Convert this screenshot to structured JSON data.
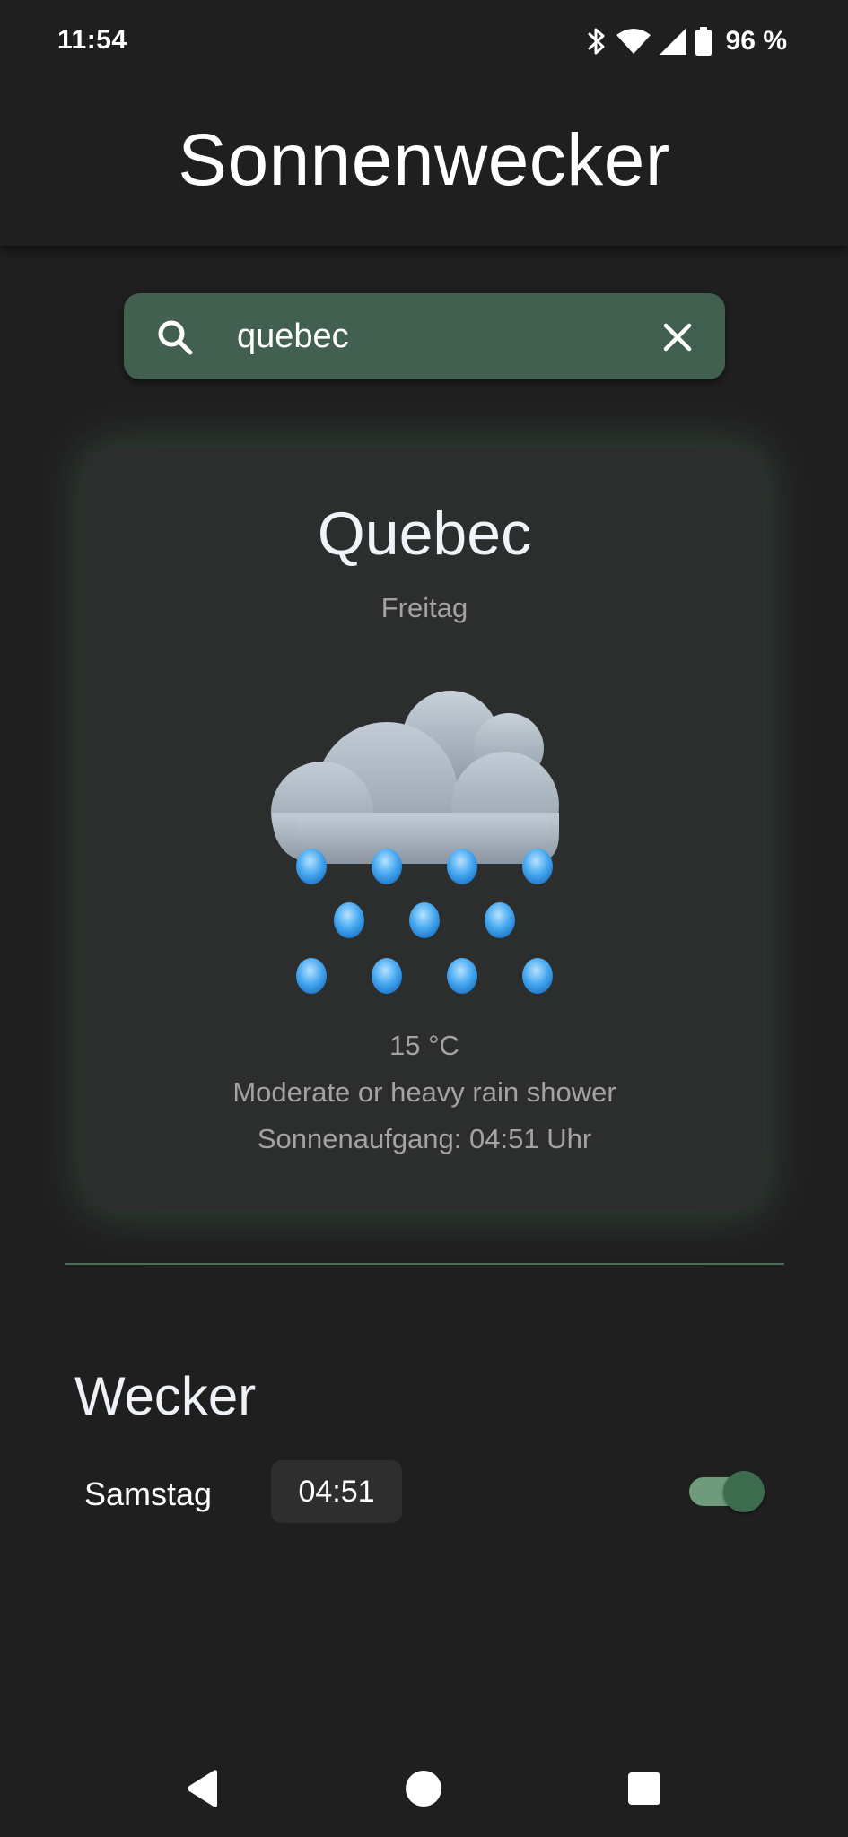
{
  "status_bar": {
    "time": "11:54",
    "battery": "96 %",
    "icons": [
      "bluetooth-icon",
      "wifi-icon",
      "cell-signal-icon",
      "battery-icon"
    ]
  },
  "app": {
    "title": "Sonnenwecker"
  },
  "search": {
    "value": "quebec",
    "icon": "search-icon",
    "clear_icon": "close-icon"
  },
  "weather": {
    "city": "Quebec",
    "day": "Freitag",
    "icon": "rain-cloud-icon",
    "temperature": "15 °C",
    "condition": "Moderate or heavy rain shower",
    "sunrise": "Sonnenaufgang: 04:51 Uhr"
  },
  "alarm": {
    "heading": "Wecker",
    "day": "Samstag",
    "time": "04:51",
    "enabled": true
  },
  "nav": {
    "icons": [
      "back-icon",
      "home-icon",
      "recents-icon"
    ]
  },
  "colors": {
    "background": "#1f1f1f",
    "search_bg": "#42604f",
    "card_bg": "#2b2e2d",
    "card_glow": "#5e926e",
    "divider": "#4d6b58",
    "toggle_track": "#6f9a7c",
    "toggle_thumb": "#3d6b4e",
    "secondary_text": "#a3a3a3",
    "rain_drop": "#3fa3ee"
  }
}
